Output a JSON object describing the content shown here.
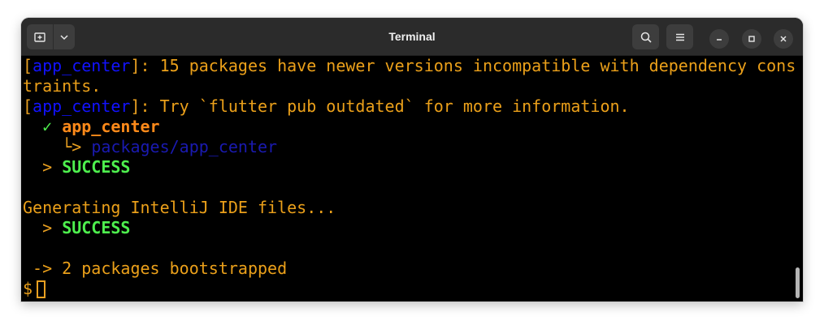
{
  "window": {
    "title": "Terminal"
  },
  "titlebar": {
    "icons": [
      "new-tab-icon",
      "chevron-down-icon",
      "search-icon",
      "hamburger-menu-icon",
      "minimize-icon",
      "maximize-icon",
      "close-icon"
    ]
  },
  "terminal": {
    "line1": {
      "bracket_open": "[",
      "tag": "app_center",
      "bracket_close": "]",
      "text": ": 15 packages have newer versions incompatible with dependency cons"
    },
    "line2": {
      "text": "traints."
    },
    "line3": {
      "bracket_open": "[",
      "tag": "app_center",
      "bracket_close": "]",
      "text": ": Try `flutter pub outdated` for more information."
    },
    "line4": {
      "indent": "  ",
      "check": "✓",
      "package": "app_center"
    },
    "line5": {
      "indent": "    ",
      "arrow": "└>",
      "path": "packages/app_center"
    },
    "line6": {
      "indent": "  ",
      "prompt": ">",
      "status": "SUCCESS"
    },
    "line8": {
      "text": "Generating IntelliJ IDE files..."
    },
    "line9": {
      "indent": "  ",
      "prompt": ">",
      "status": "SUCCESS"
    },
    "line11": {
      "text": " -> 2 packages bootstrapped"
    },
    "line12": {
      "prompt": "$"
    }
  },
  "colors": {
    "background": "#000000",
    "text": "#eba01a",
    "tag_blue": "#1212ff",
    "path_blue": "#1a1ab0",
    "package_orange": "#ff8a1a",
    "success_green": "#4ef04e",
    "titlebar": "#2b2b2b"
  }
}
